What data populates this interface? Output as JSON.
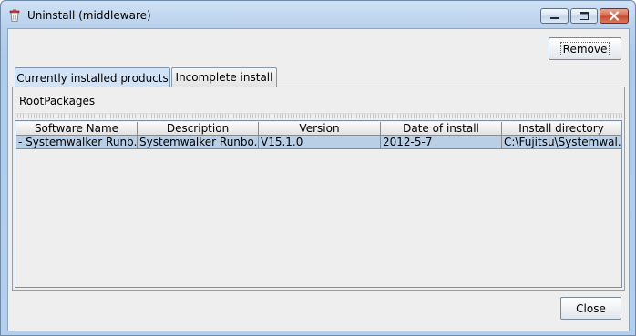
{
  "window": {
    "title": "Uninstall (middleware)"
  },
  "toolbar": {
    "remove_label": "Remove",
    "close_label": "Close"
  },
  "tabs": [
    {
      "label": "Currently installed products",
      "selected": true
    },
    {
      "label": "Incomplete install",
      "selected": false
    }
  ],
  "panel": {
    "root_label": "RootPackages"
  },
  "table": {
    "columns": [
      "Software Name",
      "Description",
      "Version",
      "Date of install",
      "Install directory"
    ],
    "rows": [
      {
        "software_name": "- Systemwalker Runb...",
        "description": "Systemwalker Runbo...",
        "version": "V15.1.0",
        "date": "2012-5-7",
        "directory": "C:\\Fujitsu\\Systemwal..."
      }
    ]
  },
  "colors": {
    "selected_row": "#b8cfe5",
    "active_tab": "#d2e3f6"
  }
}
